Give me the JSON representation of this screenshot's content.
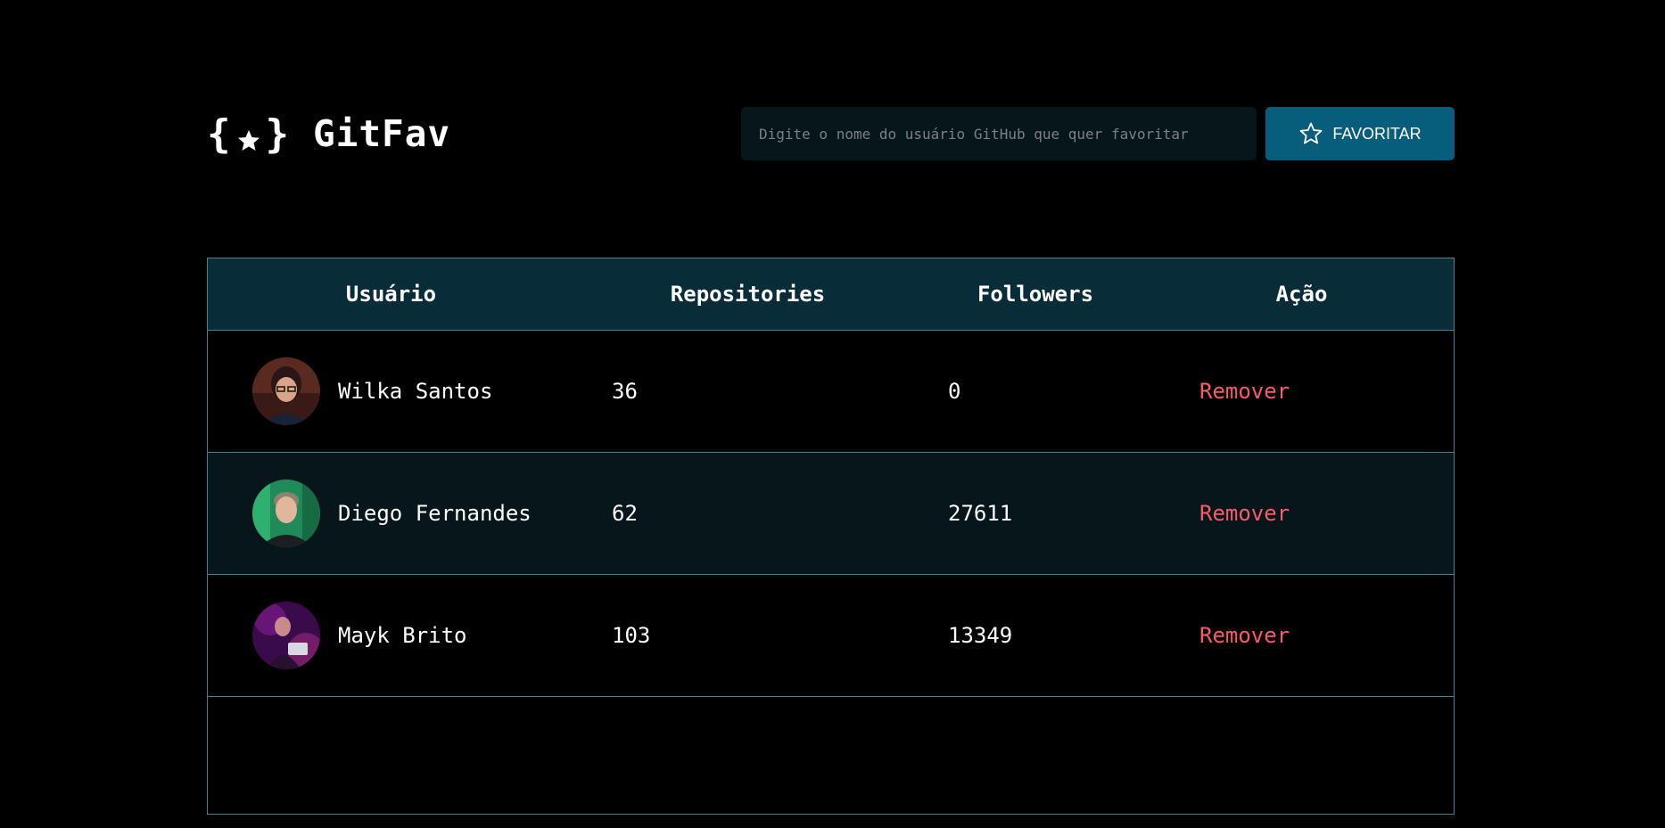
{
  "header": {
    "logo_brace_open": "{",
    "logo_brace_close": "}",
    "logo_text": "GitFav",
    "logo_icon": "star-icon",
    "search_placeholder": "Digite o nome do usuário GitHub que quer favoritar",
    "search_value": "",
    "favorite_button_label": "FAVORITAR",
    "favorite_button_icon": "star-outline-icon"
  },
  "table": {
    "headers": {
      "user": "Usuário",
      "repositories": "Repositories",
      "followers": "Followers",
      "action": "Ação"
    },
    "rows": [
      {
        "name": "Wilka Santos",
        "repositories": "36",
        "followers": "0",
        "action": "Remover",
        "avatar": "avatar-icon"
      },
      {
        "name": "Diego Fernandes",
        "repositories": "62",
        "followers": "27611",
        "action": "Remover",
        "avatar": "avatar-icon"
      },
      {
        "name": "Mayk Brito",
        "repositories": "103",
        "followers": "13349",
        "action": "Remover",
        "avatar": "avatar-icon"
      }
    ]
  },
  "colors": {
    "background": "#000000",
    "header_row": "#092d38",
    "alt_row": "#06161b",
    "border": "#4a808c",
    "button": "#065e7c",
    "remove_text": "#f75a68",
    "input_bg": "#06161b"
  }
}
